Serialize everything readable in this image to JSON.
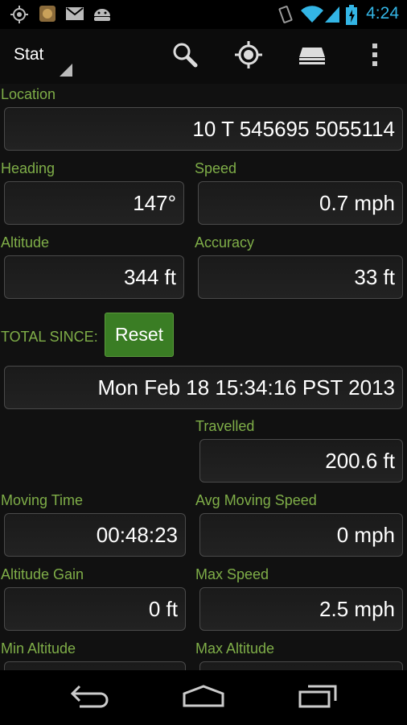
{
  "status_bar": {
    "time": "4:24",
    "left_icons": [
      "gps-icon",
      "app-notification-icon",
      "gmail-icon",
      "android-icon"
    ],
    "right_icons": [
      "vibrate-icon",
      "wifi-icon",
      "signal-icon",
      "battery-charging-icon"
    ],
    "accent_color": "#33b5e5"
  },
  "action_bar": {
    "title": "Stat",
    "actions": [
      "search-icon",
      "my-location-icon",
      "layers-icon",
      "overflow-menu-icon"
    ]
  },
  "location": {
    "label": "Location",
    "value": "10 T 545695 5055114"
  },
  "heading": {
    "label": "Heading",
    "value": "147°"
  },
  "speed": {
    "label": "Speed",
    "value": "0.7 mph"
  },
  "altitude": {
    "label": "Altitude",
    "value": "344 ft"
  },
  "accuracy": {
    "label": "Accuracy",
    "value": "33 ft"
  },
  "total_since": {
    "label": "TOTAL SINCE:",
    "reset_label": "Reset",
    "value": "Mon Feb 18 15:34:16 PST 2013"
  },
  "travelled": {
    "label": "Travelled",
    "value": "200.6 ft"
  },
  "moving_time": {
    "label": "Moving Time",
    "value": "00:48:23"
  },
  "avg_moving_speed": {
    "label": "Avg Moving Speed",
    "value": "0 mph"
  },
  "altitude_gain": {
    "label": "Altitude Gain",
    "value": "0 ft"
  },
  "max_speed": {
    "label": "Max Speed",
    "value": "2.5 mph"
  },
  "min_altitude": {
    "label": "Min Altitude",
    "value": ""
  },
  "max_altitude": {
    "label": "Max Altitude",
    "value": ""
  },
  "colors": {
    "label_green": "#7fae48",
    "reset_green": "#3a7d24",
    "background": "#111111"
  },
  "nav_bar": [
    "back-icon",
    "home-icon",
    "recent-apps-icon"
  ]
}
